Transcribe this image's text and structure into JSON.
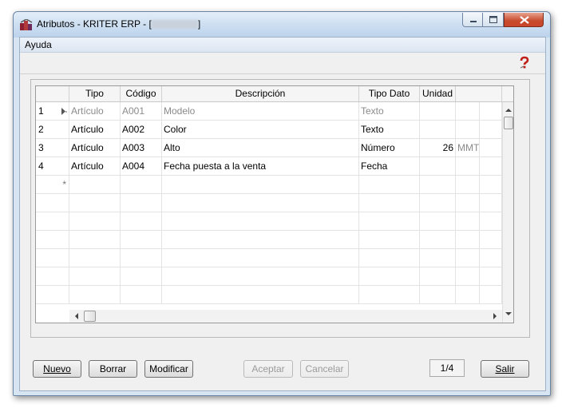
{
  "window": {
    "title": "Atributos - KRITER ERP - [",
    "title_suffix": "]"
  },
  "menu": {
    "ayuda": "Ayuda"
  },
  "grid": {
    "columns": [
      "Tipo",
      "Código",
      "Descripción",
      "Tipo Dato",
      "Unidad"
    ],
    "rows": [
      {
        "num": "1",
        "tipo": "Artículo",
        "codigo": "A001",
        "descripcion": "Modelo",
        "tipo_dato": "Texto",
        "unidad_valor": "",
        "unidad": "",
        "dim": true,
        "current": true
      },
      {
        "num": "2",
        "tipo": "Artículo",
        "codigo": "A002",
        "descripcion": "Color",
        "tipo_dato": "Texto",
        "unidad_valor": "",
        "unidad": "",
        "dim": false,
        "current": false
      },
      {
        "num": "3",
        "tipo": "Artículo",
        "codigo": "A003",
        "descripcion": "Alto",
        "tipo_dato": "Número",
        "unidad_valor": "26",
        "unidad": "MMT",
        "dim": false,
        "current": false
      },
      {
        "num": "4",
        "tipo": "Artículo",
        "codigo": "A004",
        "descripcion": "Fecha puesta a la venta",
        "tipo_dato": "Fecha",
        "unidad_valor": "",
        "unidad": "",
        "dim": false,
        "current": false
      }
    ],
    "new_row_marker": "*"
  },
  "buttons": {
    "nuevo": "Nuevo",
    "borrar": "Borrar",
    "modificar": "Modificar",
    "aceptar": "Aceptar",
    "cancelar": "Cancelar",
    "salir": "Salir"
  },
  "record_counter": "1/4",
  "icons": {
    "app": "app-icon",
    "help": "help-icon",
    "minimize": "minimize-icon",
    "maximize": "maximize-icon",
    "close": "close-icon"
  },
  "colors": {
    "title_bar": "#cfe0f2",
    "close_button": "#c84a2d",
    "help_icon": "#c0201a"
  }
}
